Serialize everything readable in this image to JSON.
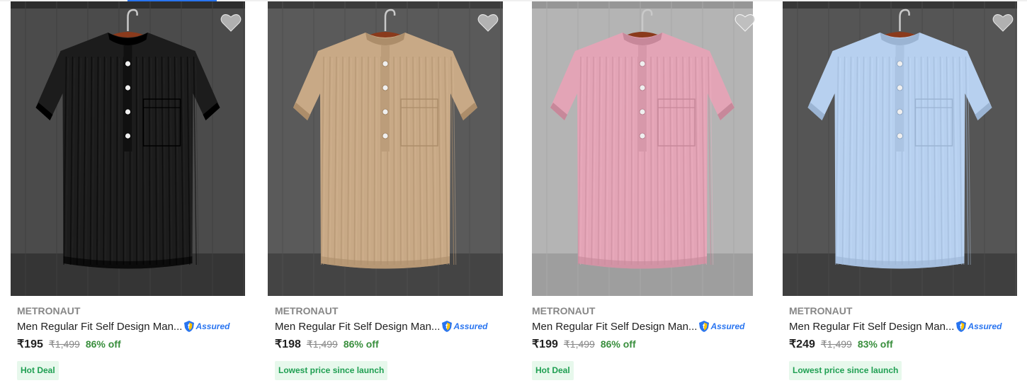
{
  "assured_label": "Assured",
  "colors": {
    "accent": "#2874f0",
    "discount": "#388e3c",
    "badge_bg": "#e7f8ec",
    "badge_text": "#1f9f52",
    "muted": "#878787",
    "text": "#212121"
  },
  "products": [
    {
      "brand": "METRONAUT",
      "title": "Men Regular Fit Self Design Man...",
      "price": "₹195",
      "mrp": "₹1,499",
      "discount": "86% off",
      "badge": "Hot Deal",
      "shirt_color": "#1c1c1c",
      "bg_color": "#4b4b4b",
      "icon": "heart-icon"
    },
    {
      "brand": "METRONAUT",
      "title": "Men Regular Fit Self Design Man...",
      "price": "₹198",
      "mrp": "₹1,499",
      "discount": "86% off",
      "badge": "Lowest price since launch",
      "shirt_color": "#c8a986",
      "bg_color": "#5a5a5a",
      "icon": "heart-icon"
    },
    {
      "brand": "METRONAUT",
      "title": "Men Regular Fit Self Design Man...",
      "price": "₹199",
      "mrp": "₹1,499",
      "discount": "86% off",
      "badge": "Hot Deal",
      "shirt_color": "#e3a4b6",
      "bg_color": "#b4b4b4",
      "icon": "heart-icon"
    },
    {
      "brand": "METRONAUT",
      "title": "Men Regular Fit Self Design Man...",
      "price": "₹249",
      "mrp": "₹1,499",
      "discount": "83% off",
      "badge": "Lowest price since launch",
      "shirt_color": "#b7d0ef",
      "bg_color": "#555555",
      "icon": "heart-icon"
    }
  ]
}
